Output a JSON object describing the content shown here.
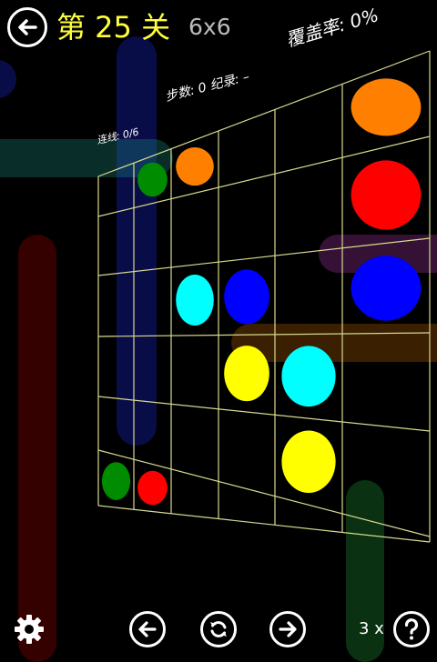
{
  "header": {
    "level_title": "第 25 关",
    "grid_size": "6x6",
    "coverage_text": "覆盖率: 0%"
  },
  "stats": {
    "moves_record_text": "步数: 0  纪录: –",
    "connections_text": "连线: 0/6"
  },
  "footer": {
    "hint_count_text": "3 x"
  },
  "icons": {
    "back": "back-arrow-icon",
    "settings": "gear-icon",
    "previous": "left-arrow-icon",
    "restart": "restart-icon",
    "next": "right-arrow-icon",
    "hint": "question-mark-icon"
  },
  "colors": {
    "title": "#ffff3c",
    "grid_lines": "#d8d890",
    "orange": "#ff8000",
    "red": "#ff0000",
    "blue": "#0000ff",
    "cyan": "#00ffff",
    "yellow": "#ffff00",
    "green": "#008c00"
  },
  "board": {
    "rows": 6,
    "cols": 6,
    "dots": [
      {
        "row": 0,
        "col": 1,
        "color": "green"
      },
      {
        "row": 0,
        "col": 2,
        "color": "orange"
      },
      {
        "row": 0,
        "col": 5,
        "color": "orange"
      },
      {
        "row": 1,
        "col": 5,
        "color": "red"
      },
      {
        "row": 2,
        "col": 2,
        "color": "cyan"
      },
      {
        "row": 2,
        "col": 3,
        "color": "blue"
      },
      {
        "row": 2,
        "col": 5,
        "color": "blue"
      },
      {
        "row": 3,
        "col": 3,
        "color": "yellow"
      },
      {
        "row": 3,
        "col": 4,
        "color": "cyan"
      },
      {
        "row": 4,
        "col": 4,
        "color": "yellow"
      },
      {
        "row": 5,
        "col": 0,
        "color": "green"
      },
      {
        "row": 5,
        "col": 1,
        "color": "red"
      }
    ]
  }
}
